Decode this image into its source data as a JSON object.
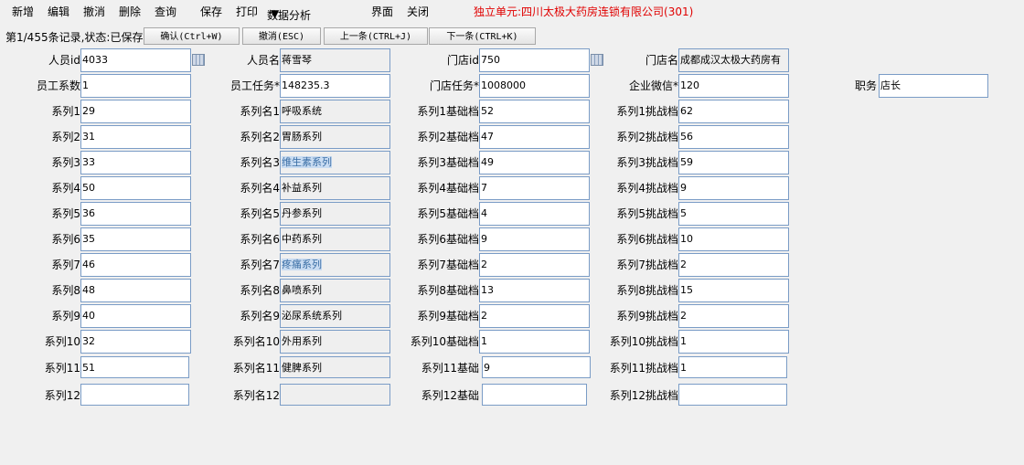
{
  "menu": {
    "new": "新增",
    "edit": "编辑",
    "undo": "撤消",
    "delete": "删除",
    "query": "查询",
    "save": "保存",
    "print": "打印",
    "analysis": "数据分析",
    "interface": "界面",
    "close": "关闭",
    "unit": "独立单元:四川太极大药房连锁有限公司(301)"
  },
  "status": "第1/455条记录,状态:已保存",
  "toolbar": {
    "confirm": "确认(Ctrl+W)",
    "cancel": "撤消(ESC)",
    "prev": "上一条(CTRL+J)",
    "next": "下一条(CTRL+K)"
  },
  "header": {
    "staff_id_label": "人员id",
    "staff_id": "4033",
    "staff_name_label": "人员名",
    "staff_name": "蒋雪琴",
    "store_id_label": "门店id",
    "store_id": "750",
    "store_name_label": "门店名",
    "store_name": "成都成汉太极大药房有",
    "coef_label": "员工系数",
    "coef": "1",
    "staff_task_label": "员工任务*",
    "staff_task": "148235.3",
    "store_task_label": "门店任务*",
    "store_task": "1008000",
    "wechat_label": "企业微信*",
    "wechat": "120",
    "position_label": "职务",
    "position": "店长"
  },
  "rows": [
    {
      "s_label": "系列1",
      "s": "29",
      "n_label": "系列名1",
      "n": "呼吸系统",
      "b_label": "系列1基础档",
      "b": "52",
      "c_label": "系列1挑战档",
      "c": "62"
    },
    {
      "s_label": "系列2",
      "s": "31",
      "n_label": "系列名2",
      "n": "胃肠系列",
      "b_label": "系列2基础档",
      "b": "47",
      "c_label": "系列2挑战档",
      "c": "56"
    },
    {
      "s_label": "系列3",
      "s": "33",
      "n_label": "系列名3",
      "n": "维生素系列",
      "b_label": "系列3基础档",
      "b": "49",
      "c_label": "系列3挑战档",
      "c": "59"
    },
    {
      "s_label": "系列4",
      "s": "50",
      "n_label": "系列名4",
      "n": "补益系列",
      "b_label": "系列4基础档",
      "b": "7",
      "c_label": "系列4挑战档",
      "c": "9"
    },
    {
      "s_label": "系列5",
      "s": "36",
      "n_label": "系列名5",
      "n": "丹参系列",
      "b_label": "系列5基础档",
      "b": "4",
      "c_label": "系列5挑战档",
      "c": "5"
    },
    {
      "s_label": "系列6",
      "s": "35",
      "n_label": "系列名6",
      "n": "中药系列",
      "b_label": "系列6基础档",
      "b": "9",
      "c_label": "系列6挑战档",
      "c": "10"
    },
    {
      "s_label": "系列7",
      "s": "46",
      "n_label": "系列名7",
      "n": "疼痛系列",
      "b_label": "系列7基础档",
      "b": "2",
      "c_label": "系列7挑战档",
      "c": "2"
    },
    {
      "s_label": "系列8",
      "s": "48",
      "n_label": "系列名8",
      "n": "鼻喷系列",
      "b_label": "系列8基础档",
      "b": "13",
      "c_label": "系列8挑战档",
      "c": "15"
    },
    {
      "s_label": "系列9",
      "s": "40",
      "n_label": "系列名9",
      "n": "泌尿系统系列",
      "b_label": "系列9基础档",
      "b": "2",
      "c_label": "系列9挑战档",
      "c": "2"
    },
    {
      "s_label": "系列10",
      "s": "32",
      "n_label": "系列名10",
      "n": "外用系列",
      "b_label": "系列10基础档",
      "b": "1",
      "c_label": "系列10挑战档",
      "c": "1"
    },
    {
      "s_label": "系列11",
      "s": "51",
      "n_label": "系列名11",
      "n": "健脾系列",
      "b_label": "系列11基础",
      "b": "9",
      "c_label": "系列11挑战档",
      "c": "1"
    },
    {
      "s_label": "系列12",
      "s": "",
      "n_label": "系列名12",
      "n": "",
      "b_label": "系列12基础",
      "b": "",
      "c_label": "系列12挑战档",
      "c": ""
    }
  ]
}
